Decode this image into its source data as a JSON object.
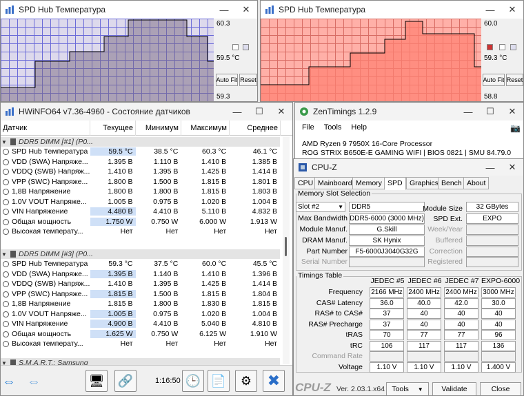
{
  "spd_left": {
    "title": "SPD Hub Температура",
    "max": "60.3",
    "cur": "59.5 °C",
    "min": "59.3",
    "auto": "Auto Fit",
    "reset": "Reset"
  },
  "spd_right": {
    "title": "SPD Hub Температура",
    "max": "60.0",
    "cur": "59.3 °C",
    "min": "58.8",
    "auto": "Auto Fit",
    "reset": "Reset"
  },
  "hwinfo": {
    "title": "HWiNFO64 v7.36-4960 - Состояние датчиков",
    "cols": [
      "Датчик",
      "Текущее",
      "Минимум",
      "Максимум",
      "Среднее"
    ],
    "group1": "DDR5 DIMM [#1] (P0...",
    "rows1": [
      [
        "SPD Hub Температура",
        "59.5 °C",
        "38.5 °C",
        "60.3 °C",
        "46.1 °C"
      ],
      [
        "VDD (SWA) Напряже...",
        "1.395 В",
        "1.110 В",
        "1.410 В",
        "1.385 В"
      ],
      [
        "VDDQ (SWB) Напряж...",
        "1.410 В",
        "1.395 В",
        "1.425 В",
        "1.414 В"
      ],
      [
        "VPP (SWC) Напряже...",
        "1.800 В",
        "1.500 В",
        "1.815 В",
        "1.801 В"
      ],
      [
        "1,8В Напряжение",
        "1.800 В",
        "1.800 В",
        "1.815 В",
        "1.803 В"
      ],
      [
        "1.0V VOUT Напряже...",
        "1.005 В",
        "0.975 В",
        "1.020 В",
        "1.004 В"
      ],
      [
        "VIN Напряжение",
        "4.480 В",
        "4.410 В",
        "5.110 В",
        "4.832 В"
      ],
      [
        "Общая мощность",
        "1.750 W",
        "0.750 W",
        "6.000 W",
        "1.913 W"
      ],
      [
        "Высокая температу...",
        "Нет",
        "Нет",
        "Нет",
        "Нет"
      ]
    ],
    "group2": "DDR5 DIMM [#3] (P0...",
    "rows2": [
      [
        "SPD Hub Температура",
        "59.3 °C",
        "37.5 °C",
        "60.0 °C",
        "45.5 °C"
      ],
      [
        "VDD (SWA) Напряже...",
        "1.395 В",
        "1.140 В",
        "1.410 В",
        "1.396 В"
      ],
      [
        "VDDQ (SWB) Напряж...",
        "1.410 В",
        "1.395 В",
        "1.425 В",
        "1.414 В"
      ],
      [
        "VPP (SWC) Напряже...",
        "1.815 В",
        "1.500 В",
        "1.815 В",
        "1.804 В"
      ],
      [
        "1,8В Напряжение",
        "1.815 В",
        "1.800 В",
        "1.830 В",
        "1.815 В"
      ],
      [
        "1.0V VOUT Напряже...",
        "1.005 В",
        "0.975 В",
        "1.020 В",
        "1.004 В"
      ],
      [
        "VIN Напряжение",
        "4.900 В",
        "4.410 В",
        "5.040 В",
        "4.810 В"
      ],
      [
        "Общая мощность",
        "1.625 W",
        "0.750 W",
        "6.125 W",
        "1.910 W"
      ],
      [
        "Высокая температу...",
        "Нет",
        "Нет",
        "Нет",
        "Нет"
      ]
    ],
    "group3": "S.M.A.R.T.: Samsung",
    "time": "1:16:50"
  },
  "zen": {
    "title": "ZenTimings 1.2.9",
    "menu": [
      "File",
      "Tools",
      "Help"
    ],
    "cpu": "AMD Ryzen 9 7950X 16-Core Processor",
    "board": "ROG STRIX B650E-E GAMING WIFI | BIOS 0821 | SMU 84.79.0"
  },
  "cpuz": {
    "title": "CPU-Z",
    "tabs": [
      "CPU",
      "Mainboard",
      "Memory",
      "SPD",
      "Graphics",
      "Bench",
      "About"
    ],
    "sel_title": "Memory Slot Selection",
    "slot": "Slot #2",
    "type": "DDR5",
    "labels": [
      "Max Bandwidth",
      "Module Manuf.",
      "DRAM Manuf.",
      "Part Number",
      "Serial Number"
    ],
    "values": [
      "DDR5-6000 (3000 MHz)",
      "G.Skill",
      "SK Hynix",
      "F5-6000J3040G32G",
      ""
    ],
    "rlabels": [
      "Module Size",
      "SPD Ext.",
      "Week/Year",
      "Buffered",
      "Correction",
      "Registered"
    ],
    "rvalues": [
      "32 GBytes",
      "EXPO",
      "",
      "",
      "",
      ""
    ],
    "tt_title": "Timings Table",
    "tcols": [
      "JEDEC #5",
      "JEDEC #6",
      "JEDEC #7",
      "EXPO-6000"
    ],
    "trows": [
      [
        "Frequency",
        "2166 MHz",
        "2400 MHz",
        "2400 MHz",
        "3000 MHz"
      ],
      [
        "CAS# Latency",
        "36.0",
        "40.0",
        "42.0",
        "30.0"
      ],
      [
        "RAS# to CAS#",
        "37",
        "40",
        "40",
        "40"
      ],
      [
        "RAS# Precharge",
        "37",
        "40",
        "40",
        "40"
      ],
      [
        "tRAS",
        "70",
        "77",
        "77",
        "96"
      ],
      [
        "tRC",
        "106",
        "117",
        "117",
        "136"
      ],
      [
        "Command Rate",
        "",
        "",
        "",
        ""
      ],
      [
        "Voltage",
        "1.10 V",
        "1.10 V",
        "1.10 V",
        "1.400 V"
      ]
    ],
    "logo": "CPU-Z",
    "version": "Ver. 2.03.1.x64",
    "btn_tools": "Tools",
    "btn_validate": "Validate",
    "btn_close": "Close"
  }
}
